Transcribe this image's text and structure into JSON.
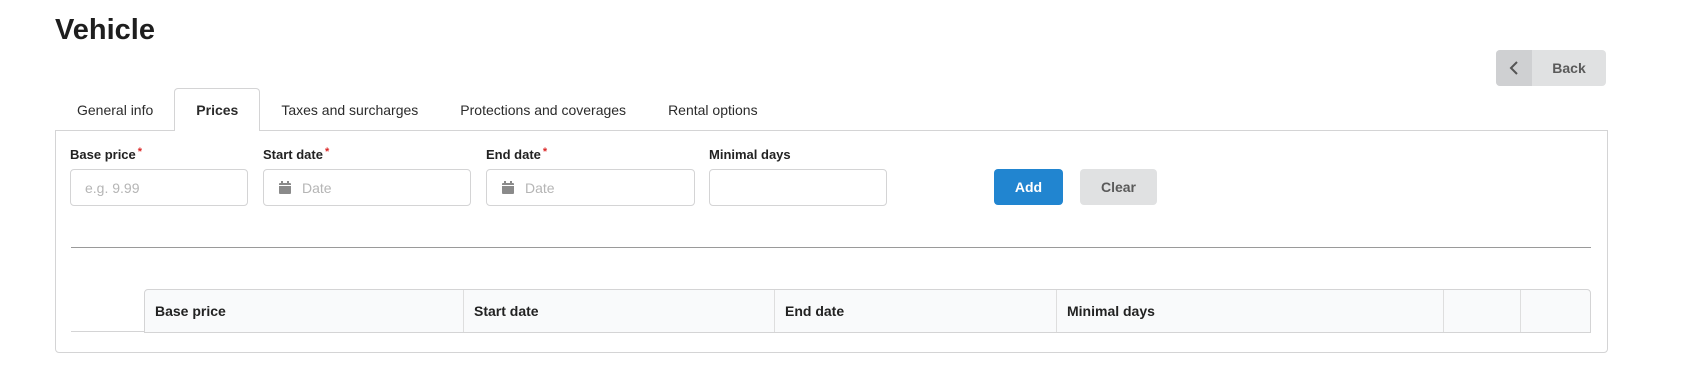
{
  "page": {
    "title": "Vehicle"
  },
  "header": {
    "back_label": "Back"
  },
  "tabs": [
    {
      "label": "General info",
      "active": false
    },
    {
      "label": "Prices",
      "active": true
    },
    {
      "label": "Taxes and surcharges",
      "active": false
    },
    {
      "label": "Protections and coverages",
      "active": false
    },
    {
      "label": "Rental options",
      "active": false
    }
  ],
  "form": {
    "base_price": {
      "label": "Base price",
      "required_mark": "*",
      "placeholder": "e.g. 9.99",
      "value": ""
    },
    "start_date": {
      "label": "Start date",
      "required_mark": "*",
      "placeholder": "Date",
      "value": ""
    },
    "end_date": {
      "label": "End date",
      "required_mark": "*",
      "placeholder": "Date",
      "value": ""
    },
    "minimal_days": {
      "label": "Minimal days",
      "placeholder": "",
      "value": ""
    },
    "add_label": "Add",
    "clear_label": "Clear"
  },
  "table": {
    "columns": [
      "Base price",
      "Start date",
      "End date",
      "Minimal days",
      "",
      ""
    ],
    "rows": []
  },
  "icons": {
    "back": "chevron-left-icon",
    "calendar": "calendar-icon"
  },
  "colors": {
    "primary": "#2185d0",
    "required": "#db2828",
    "secondary_button": "#e0e1e2"
  }
}
